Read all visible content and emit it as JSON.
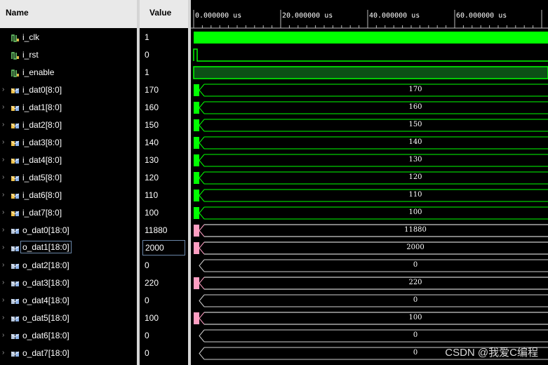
{
  "header": {
    "name_label": "Name",
    "value_label": "Value"
  },
  "timeline": {
    "ticks": [
      "0.000000 us",
      "20.000000 us",
      "40.000000 us",
      "60.000000 us"
    ],
    "colors": {
      "input": "#00ff00",
      "output": "#ff9ec2",
      "dim_output": "#d0d0d0"
    }
  },
  "signals": [
    {
      "name": "i_clk",
      "value": "1",
      "kind": "bit",
      "wave": "clock",
      "expandable": false
    },
    {
      "name": "i_rst",
      "value": "0",
      "kind": "bit",
      "wave": "pulse",
      "expandable": false
    },
    {
      "name": "i_enable",
      "value": "1",
      "kind": "bit",
      "wave": "high",
      "expandable": false
    },
    {
      "name": "i_dat0[8:0]",
      "value": "170",
      "kind": "in",
      "wave": "bus",
      "bus_value": "170",
      "expandable": true
    },
    {
      "name": "i_dat1[8:0]",
      "value": "160",
      "kind": "in",
      "wave": "bus",
      "bus_value": "160",
      "expandable": true
    },
    {
      "name": "i_dat2[8:0]",
      "value": "150",
      "kind": "in",
      "wave": "bus",
      "bus_value": "150",
      "expandable": true
    },
    {
      "name": "i_dat3[8:0]",
      "value": "140",
      "kind": "in",
      "wave": "bus",
      "bus_value": "140",
      "expandable": true
    },
    {
      "name": "i_dat4[8:0]",
      "value": "130",
      "kind": "in",
      "wave": "bus",
      "bus_value": "130",
      "expandable": true
    },
    {
      "name": "i_dat5[8:0]",
      "value": "120",
      "kind": "in",
      "wave": "bus",
      "bus_value": "120",
      "expandable": true
    },
    {
      "name": "i_dat6[8:0]",
      "value": "110",
      "kind": "in",
      "wave": "bus",
      "bus_value": "110",
      "expandable": true
    },
    {
      "name": "i_dat7[8:0]",
      "value": "100",
      "kind": "in",
      "wave": "bus",
      "bus_value": "100",
      "expandable": true
    },
    {
      "name": "o_dat0[18:0]",
      "value": "11880",
      "kind": "out",
      "wave": "bus",
      "bus_value": "11880",
      "expandable": true
    },
    {
      "name": "o_dat1[18:0]",
      "value": "2000",
      "kind": "out",
      "wave": "bus",
      "bus_value": "2000",
      "expandable": true,
      "selected": true
    },
    {
      "name": "o_dat2[18:0]",
      "value": "0",
      "kind": "out",
      "wave": "bus",
      "bus_value": "0",
      "expandable": true,
      "zero": true
    },
    {
      "name": "o_dat3[18:0]",
      "value": "220",
      "kind": "out",
      "wave": "bus",
      "bus_value": "220",
      "expandable": true
    },
    {
      "name": "o_dat4[18:0]",
      "value": "0",
      "kind": "out",
      "wave": "bus",
      "bus_value": "0",
      "expandable": true,
      "zero": true
    },
    {
      "name": "o_dat5[18:0]",
      "value": "100",
      "kind": "out",
      "wave": "bus",
      "bus_value": "100",
      "expandable": true
    },
    {
      "name": "o_dat6[18:0]",
      "value": "0",
      "kind": "out",
      "wave": "bus",
      "bus_value": "0",
      "expandable": true,
      "zero": true
    },
    {
      "name": "o_dat7[18:0]",
      "value": "0",
      "kind": "out",
      "wave": "bus",
      "bus_value": "0",
      "expandable": true,
      "zero": true
    }
  ],
  "watermark": "CSDN @我爱C编程"
}
